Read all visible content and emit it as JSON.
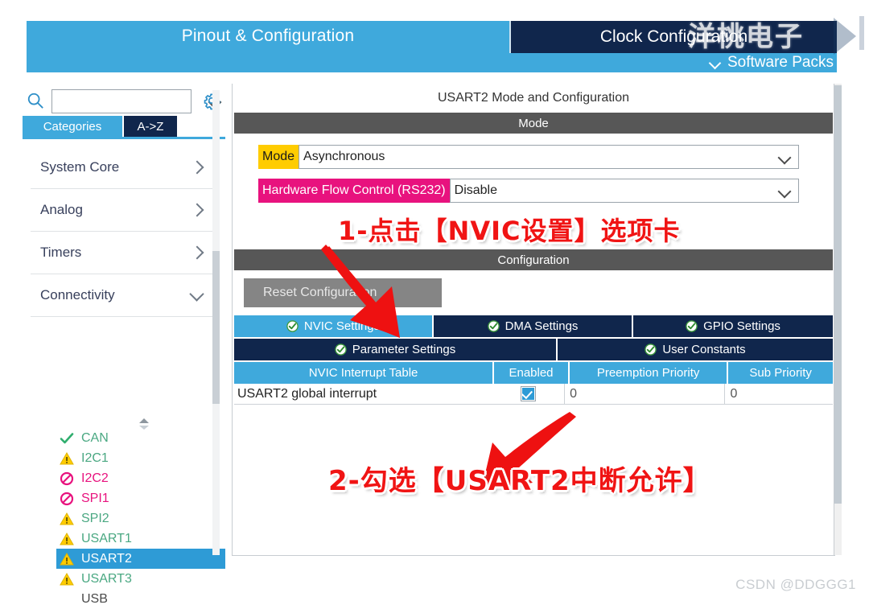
{
  "header": {
    "tab_pinout": "Pinout & Configuration",
    "tab_clock": "Clock Configuration",
    "software_packs": "Software Packs",
    "watermark": "洋桃电子"
  },
  "sidebar": {
    "search_value": "",
    "search_placeholder": "",
    "tab_categories": "Categories",
    "tab_az": "A->Z",
    "categories": [
      {
        "label": "System Core",
        "arrow": "right"
      },
      {
        "label": "Analog",
        "arrow": "right"
      },
      {
        "label": "Timers",
        "arrow": "right"
      },
      {
        "label": "Connectivity",
        "arrow": "down"
      }
    ],
    "peripherals": [
      {
        "label": "CAN",
        "status": "ok",
        "selected": false
      },
      {
        "label": "I2C1",
        "status": "warning",
        "selected": false
      },
      {
        "label": "I2C2",
        "status": "disabled",
        "selected": false
      },
      {
        "label": "SPI1",
        "status": "disabled",
        "selected": false
      },
      {
        "label": "SPI2",
        "status": "warning",
        "selected": false
      },
      {
        "label": "USART1",
        "status": "warning",
        "selected": false
      },
      {
        "label": "USART2",
        "status": "warning",
        "selected": true
      },
      {
        "label": "USART3",
        "status": "warning",
        "selected": false
      },
      {
        "label": "USB",
        "status": "none",
        "selected": false
      }
    ]
  },
  "main": {
    "title": "USART2 Mode and Configuration",
    "mode_section_label": "Mode",
    "mode_field_label": "Mode",
    "mode_field_value": "Asynchronous",
    "flow_field_label": "Hardware Flow Control (RS232)",
    "flow_field_value": "Disable",
    "configuration_section_label": "Configuration",
    "reset_button": "Reset Configuration",
    "tabs_row1": [
      {
        "label": "NVIC Settings",
        "active": true
      },
      {
        "label": "DMA Settings",
        "active": false
      },
      {
        "label": "GPIO Settings",
        "active": false
      }
    ],
    "tabs_row2": [
      {
        "label": "Parameter Settings",
        "active": false
      },
      {
        "label": "User Constants",
        "active": false
      }
    ],
    "table": {
      "headers": [
        "NVIC Interrupt Table",
        "Enabled",
        "Preemption Priority",
        "Sub Priority"
      ],
      "rows": [
        {
          "name": "USART2 global interrupt",
          "enabled": true,
          "preemption": "0",
          "sub": "0"
        }
      ]
    }
  },
  "annotations": {
    "step1": "1-点击【NVIC设置】选项卡",
    "step2": "2-勾选【USART2中断允许】"
  },
  "footer": {
    "watermark": "CSDN @DDGGG1"
  },
  "colors": {
    "light_blue": "#3FA9DC",
    "dark_navy": "#10264C",
    "section_gray": "#575757",
    "highlight_yellow": "#FFCC00",
    "highlight_magenta": "#E8127E",
    "annotation_red": "#F01414",
    "selected_blue": "#2E9BD6"
  }
}
